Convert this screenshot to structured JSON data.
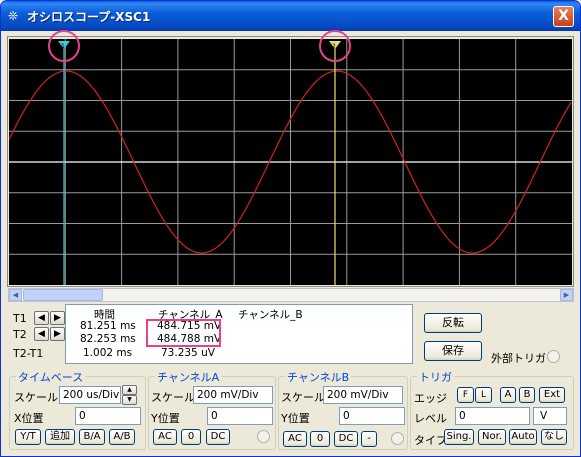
{
  "window": {
    "title": "オシロスコープ-XSC1",
    "close_label": "X"
  },
  "scope": {
    "colors": {
      "background": "#000000",
      "grid": "#9a9a9a",
      "trace_a": "#d42020",
      "trace_b": "#ffffff",
      "cursor_1": "#40c8d8",
      "cursor_2": "#e8e070",
      "highlight": "#e8408f"
    }
  },
  "cursors": {
    "t1_label": "T1",
    "t2_label": "T2",
    "diff_label": "T2-T1",
    "headers": {
      "time": "時間",
      "channel_a": "チャンネル_A",
      "channel_b": "チャンネル_B"
    },
    "rows": [
      {
        "time": "81.251 ms",
        "channel_a": "484.715 mV",
        "channel_b": ""
      },
      {
        "time": "82.253 ms",
        "channel_a": "484.788 mV",
        "channel_b": ""
      },
      {
        "time": "1.002 ms",
        "channel_a": "73.235 uV",
        "channel_b": ""
      }
    ]
  },
  "buttons": {
    "reverse": "反転",
    "save": "保存",
    "ext_trigger": "外部トリガ"
  },
  "timebase": {
    "title": "タイムベース",
    "scale_label": "スケール",
    "scale_value": "200 us/Div",
    "xpos_label": "X位置",
    "xpos_value": "0",
    "mode_buttons": [
      "Y/T",
      "追加",
      "B/A",
      "A/B"
    ]
  },
  "channel_a": {
    "title": "チャンネルA",
    "scale_label": "スケール",
    "scale_value": "200 mV/Div",
    "ypos_label": "Y位置",
    "ypos_value": "0",
    "coupling": [
      "AC",
      "0",
      "DC"
    ]
  },
  "channel_b": {
    "title": "チャンネルB",
    "scale_label": "スケール",
    "scale_value": "200 mV/Div",
    "ypos_label": "Y位置",
    "ypos_value": "0",
    "coupling": [
      "AC",
      "0",
      "DC",
      "-"
    ]
  },
  "trigger": {
    "title": "トリガ",
    "edge_label": "エッジ",
    "edge_buttons": [
      "F",
      "L",
      "A",
      "B",
      "Ext"
    ],
    "level_label": "レベル",
    "level_value": "0",
    "level_unit": "V",
    "type_label": "タイプ",
    "type_buttons": [
      "Sing.",
      "Nor.",
      "Auto",
      "なし"
    ]
  }
}
